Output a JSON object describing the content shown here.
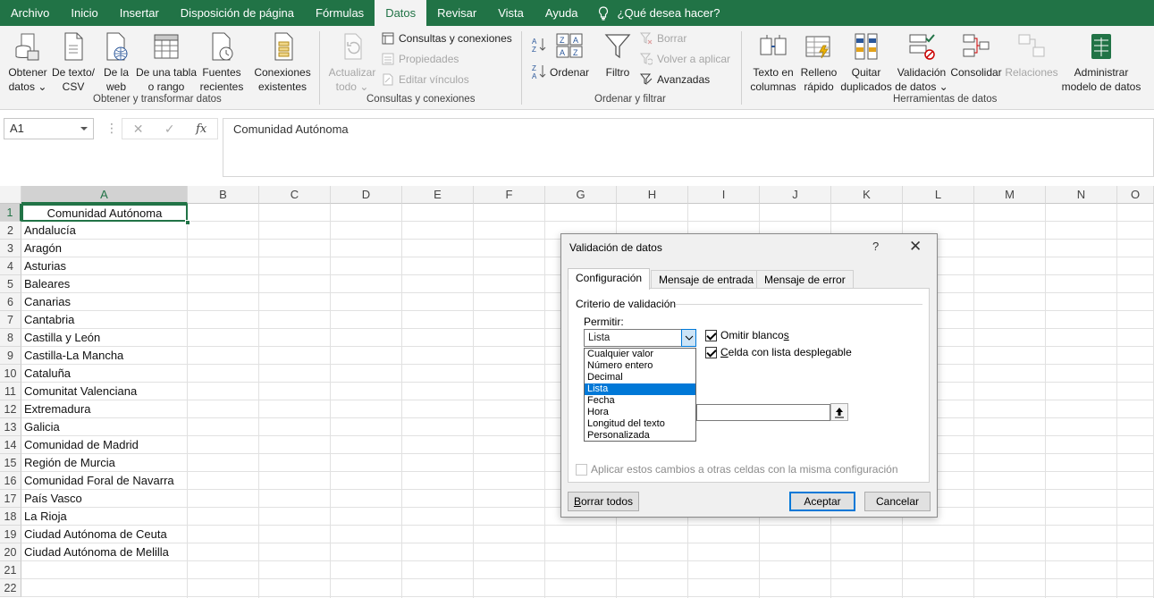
{
  "menubar": {
    "tabs": [
      "Archivo",
      "Inicio",
      "Insertar",
      "Disposición de página",
      "Fórmulas",
      "Datos",
      "Revisar",
      "Vista",
      "Ayuda"
    ],
    "active_tab": "Datos",
    "tell_me": "¿Qué desea hacer?"
  },
  "ribbon": {
    "get_data": {
      "obtener_line1": "Obtener",
      "obtener_line2": "datos ⌄",
      "texto_line1": "De texto/",
      "texto_line2": "CSV",
      "web_line1": "De la",
      "web_line2": "web",
      "tabla_line1": "De una tabla",
      "tabla_line2": "o rango",
      "fuentes_line1": "Fuentes",
      "fuentes_line2": "recientes",
      "conexiones_line1": "Conexiones",
      "conexiones_line2": "existentes",
      "group_label": "Obtener y transformar datos"
    },
    "queries": {
      "actualizar_line1": "Actualizar",
      "actualizar_line2": "todo ⌄",
      "consultas": "Consultas y conexiones",
      "propiedades": "Propiedades",
      "editar": "Editar vínculos",
      "group_label": "Consultas y conexiones"
    },
    "sort": {
      "ordenar": "Ordenar",
      "filtro": "Filtro",
      "borrar": "Borrar",
      "volver": "Volver a aplicar",
      "avanzadas": "Avanzadas",
      "group_label": "Ordenar y filtrar"
    },
    "tools": {
      "texto_line1": "Texto en",
      "texto_line2": "columnas",
      "relleno_line1": "Relleno",
      "relleno_line2": "rápido",
      "quitar_line1": "Quitar",
      "quitar_line2": "duplicados",
      "validacion_line1": "Validación",
      "validacion_line2": "de datos ⌄",
      "consolidar": "Consolidar",
      "relaciones": "Relaciones",
      "admin_line1": "Administrar",
      "admin_line2": "modelo de datos",
      "group_label": "Herramientas de datos"
    }
  },
  "formula_bar": {
    "name_box": "A1",
    "dots": "⋮",
    "cancel": "✕",
    "enter": "✓",
    "fx": "fx",
    "content": "Comunidad Autónoma"
  },
  "sheet": {
    "columns": [
      "A",
      "B",
      "C",
      "D",
      "E",
      "F",
      "G",
      "H",
      "I",
      "J",
      "K",
      "L",
      "M",
      "N",
      "O"
    ],
    "rows": [
      "1",
      "2",
      "3",
      "4",
      "5",
      "6",
      "7",
      "8",
      "9",
      "10",
      "11",
      "12",
      "13",
      "14",
      "15",
      "16",
      "17",
      "18",
      "19",
      "20",
      "21",
      "22"
    ],
    "column_a": [
      "Comunidad Autónoma",
      "Andalucía",
      "Aragón",
      "Asturias",
      "Baleares",
      "Canarias",
      "Cantabria",
      "Castilla y León",
      "Castilla-La Mancha",
      "Cataluña",
      "Comunitat Valenciana",
      "Extremadura",
      "Galicia",
      "Comunidad de Madrid",
      "Región de Murcia",
      "Comunidad Foral de Navarra",
      "País Vasco",
      "La Rioja",
      "Ciudad Autónoma de Ceuta",
      "Ciudad Autónoma de Melilla"
    ]
  },
  "dialog": {
    "title": "Validación de datos",
    "help": "?",
    "close": "✕",
    "tabs": [
      "Configuración",
      "Mensaje de entrada",
      "Mensaje de error"
    ],
    "section": "Criterio de validación",
    "permitir_label": "Permitir:",
    "permitir_value": "Lista",
    "options": [
      "Cualquier valor",
      "Número entero",
      "Decimal",
      "Lista",
      "Fecha",
      "Hora",
      "Longitud del texto",
      "Personalizada"
    ],
    "selected_option": "Lista",
    "omitir_pre": "Omitir blanco",
    "omitir_u": "s",
    "celda_u": "C",
    "celda_rest": "elda con lista desplegable",
    "apply_all": "Aplicar estos cambios a otras celdas con la misma configuración",
    "clear_u": "B",
    "clear_rest": "orrar todos",
    "ok": "Aceptar",
    "cancel": "Cancelar"
  },
  "colors": {
    "brand": "#217346",
    "select": "#0078d7"
  }
}
